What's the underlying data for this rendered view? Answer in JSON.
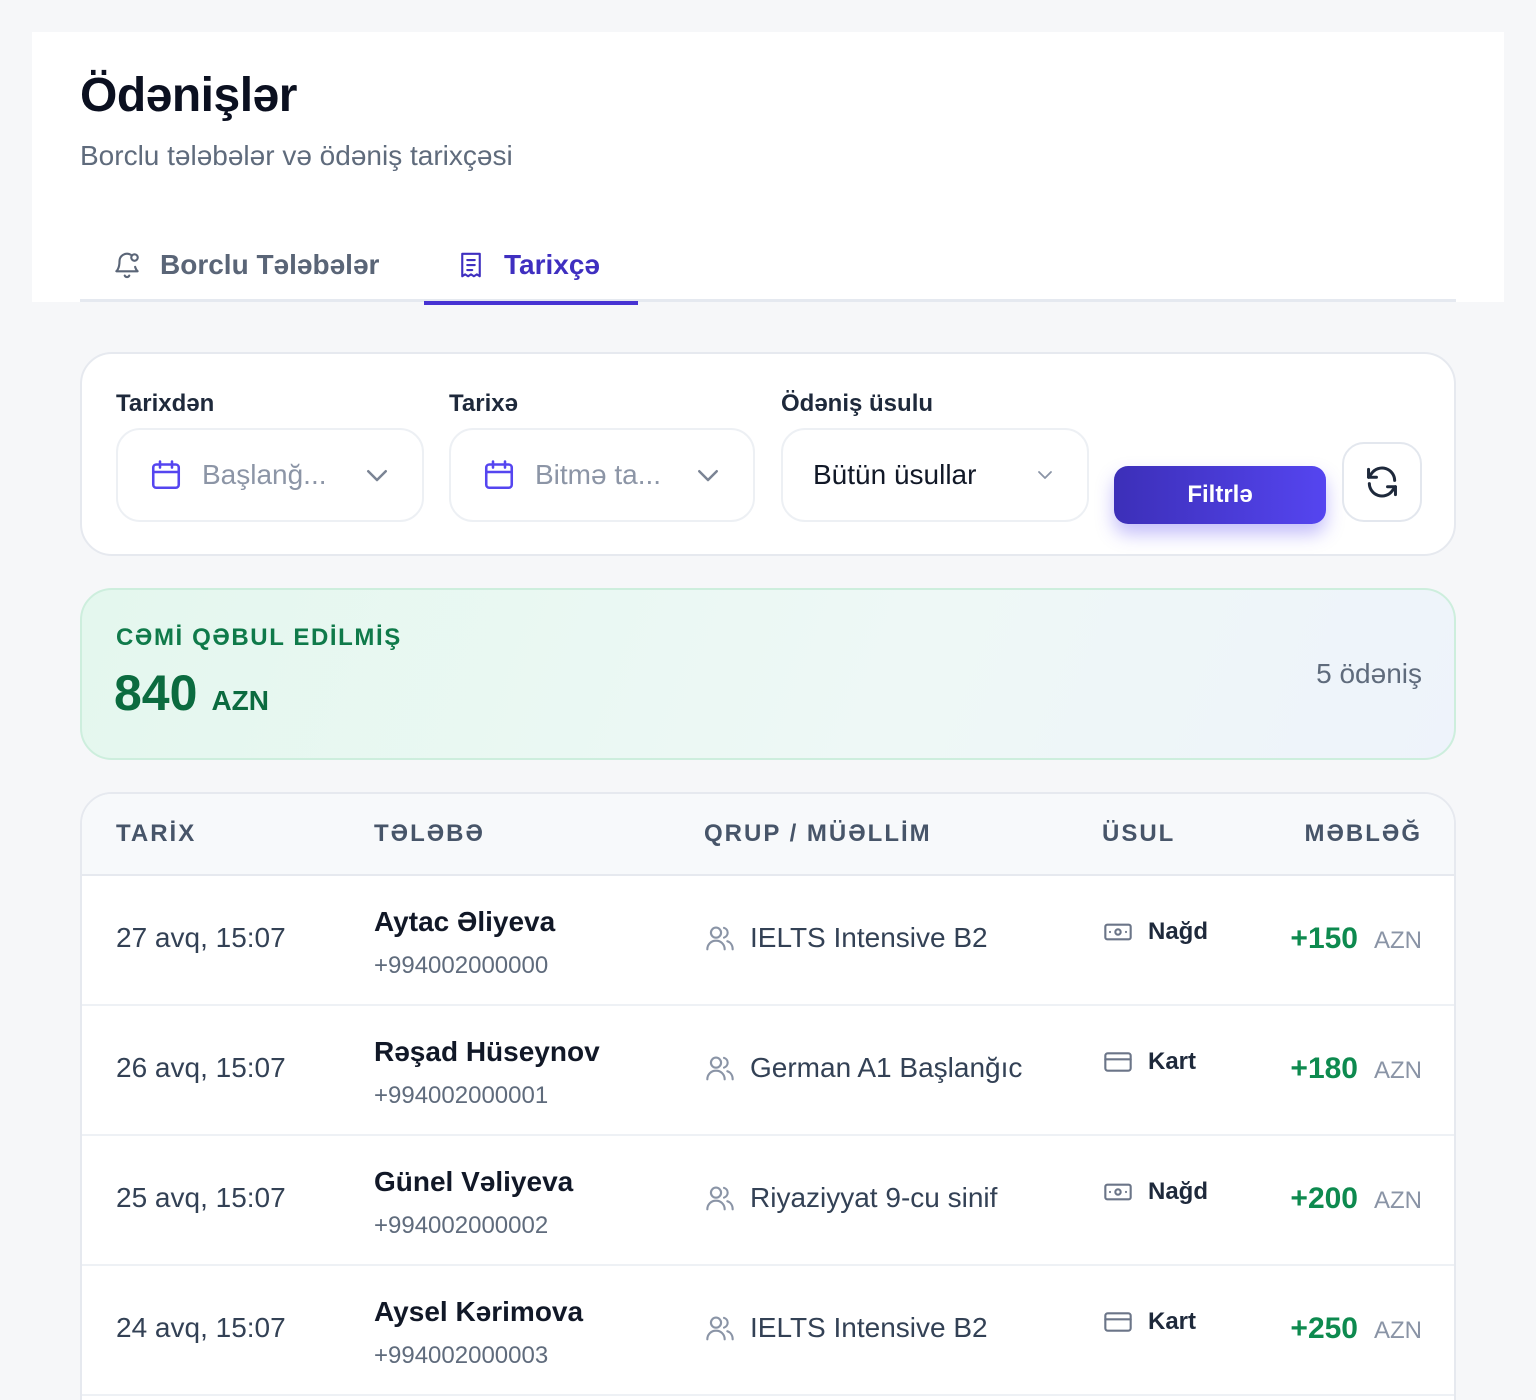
{
  "header": {
    "title": "Ödənişlər",
    "subtitle": "Borclu tələbələr və ödəniş tarixçəsi"
  },
  "tabs": [
    {
      "label": "Borclu Tələbələr",
      "icon": "bell-icon",
      "active": false
    },
    {
      "label": "Tarixçə",
      "icon": "receipt-icon",
      "active": true
    }
  ],
  "filters": {
    "from": {
      "label": "Tarixdən",
      "placeholder": "Başlanğ..."
    },
    "to": {
      "label": "Tarixə",
      "placeholder": "Bitmə ta..."
    },
    "method": {
      "label": "Ödəniş üsulu",
      "value": "Bütün üsullar"
    },
    "filter_button": "Filtrlə",
    "refresh_icon": "refresh-icon"
  },
  "summary": {
    "label": "CƏMİ QƏBUL EDİLMİŞ",
    "amount": "840",
    "currency": "AZN",
    "count": "5 ödəniş"
  },
  "table": {
    "columns": [
      "TARİX",
      "TƏLƏBƏ",
      "QRUP / MÜƏLLİM",
      "ÜSUL",
      "MƏBLƏĞ"
    ],
    "rows": [
      {
        "date": "27 avq, 15:07",
        "name": "Aytac Əliyeva",
        "phone": "+994002000000",
        "group": "IELTS Intensive B2",
        "method": "Nağd",
        "method_icon": "cash-icon",
        "amount": "+150",
        "currency": "AZN"
      },
      {
        "date": "26 avq, 15:07",
        "name": "Rəşad Hüseynov",
        "phone": "+994002000001",
        "group": "German A1 Başlanğıc",
        "method": "Kart",
        "method_icon": "card-icon",
        "amount": "+180",
        "currency": "AZN"
      },
      {
        "date": "25 avq, 15:07",
        "name": "Günel Vəliyeva",
        "phone": "+994002000002",
        "group": "Riyaziyyat 9-cu sinif",
        "method": "Nağd",
        "method_icon": "cash-icon",
        "amount": "+200",
        "currency": "AZN"
      },
      {
        "date": "24 avq, 15:07",
        "name": "Aysel Kərimova",
        "phone": "+994002000003",
        "group": "IELTS Intensive B2",
        "method": "Kart",
        "method_icon": "card-icon",
        "amount": "+250",
        "currency": "AZN"
      }
    ]
  },
  "colors": {
    "accent": "#4733d3",
    "success": "#0e8a4f",
    "summary_text": "#0b6b3f"
  }
}
